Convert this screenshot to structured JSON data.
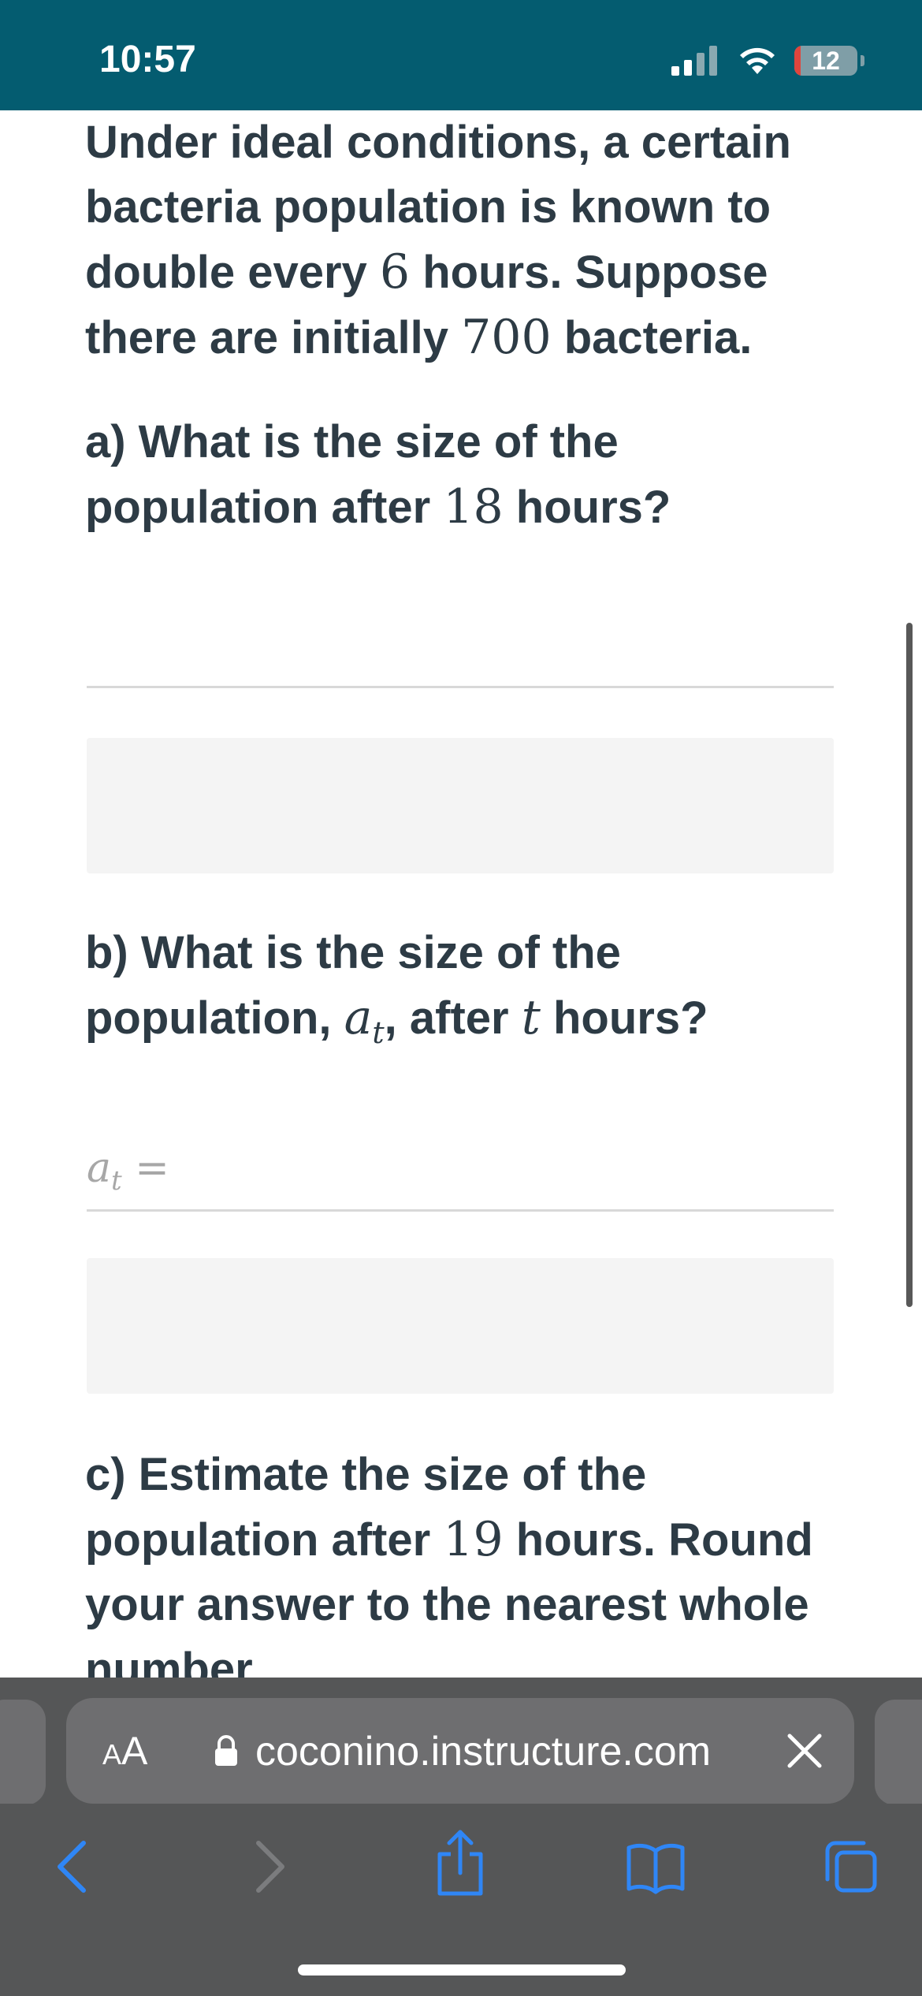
{
  "status_bar": {
    "time": "10:57",
    "battery_level": "12",
    "background_color": "#045c70"
  },
  "question": {
    "intro": {
      "t1": "Under ideal conditions, a certain bacteria population is known to double every ",
      "m1": "6",
      "t2": " hours. Suppose there are initially ",
      "m2": "700",
      "t3": " bacteria."
    },
    "part_a": {
      "t1": "a) What is the size of the population after ",
      "m1": "18",
      "t2": " hours?"
    },
    "part_b": {
      "t1": "b) What is the size of the population, ",
      "m1_base": "a",
      "m1_sub": "t",
      "t2": ", after ",
      "m2": "t",
      "t3": " hours?",
      "answer_prefix_base": "a",
      "answer_prefix_sub": "t",
      "answer_prefix_eq": " ="
    },
    "part_c": {
      "t1": "c) Estimate the size of the population after ",
      "m1": "19",
      "t2": " hours. Round your answer to the nearest whole number."
    }
  },
  "browser": {
    "text_size_label_small": "A",
    "text_size_label_large": "A",
    "url": "coconino.instructure.com",
    "toolbar_icons": [
      "back-icon",
      "forward-icon",
      "share-icon",
      "bookmarks-icon",
      "tabs-icon"
    ],
    "accent_color": "#2f86f6"
  }
}
